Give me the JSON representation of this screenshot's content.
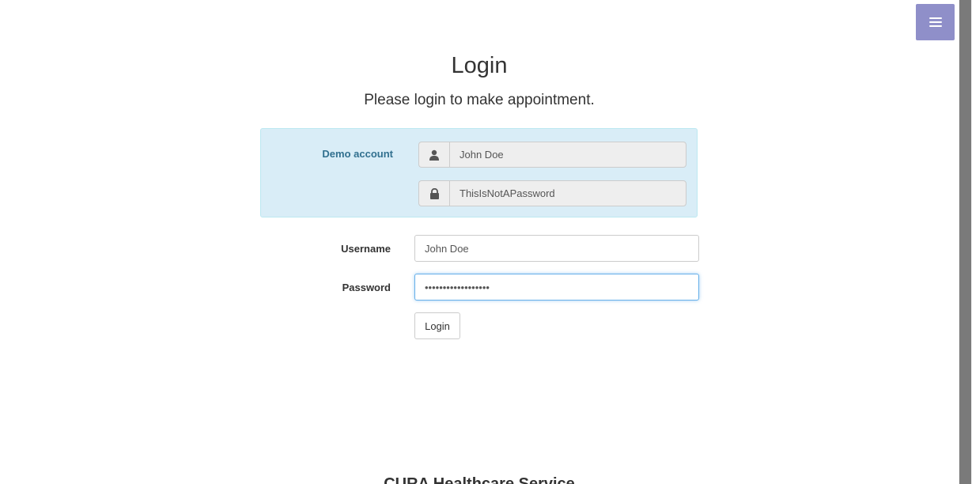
{
  "header": {
    "title": "Login",
    "subtitle": "Please login to make appointment."
  },
  "demo": {
    "label": "Demo account",
    "username": "John Doe",
    "password": "ThisIsNotAPassword",
    "username_icon": "user-icon",
    "password_icon": "lock-icon"
  },
  "form": {
    "username_label": "Username",
    "password_label": "Password",
    "username_value": "John Doe",
    "password_value": "••••••••••••••••••",
    "login_button": "Login"
  },
  "menu": {
    "icon": "hamburger-menu-icon",
    "color": "#8f8fc9"
  },
  "footer": {
    "brand": "CURA Healthcare Service"
  },
  "colors": {
    "demo_background": "#d9edf7",
    "demo_label": "#31708f",
    "focus_border": "#66afe9"
  }
}
